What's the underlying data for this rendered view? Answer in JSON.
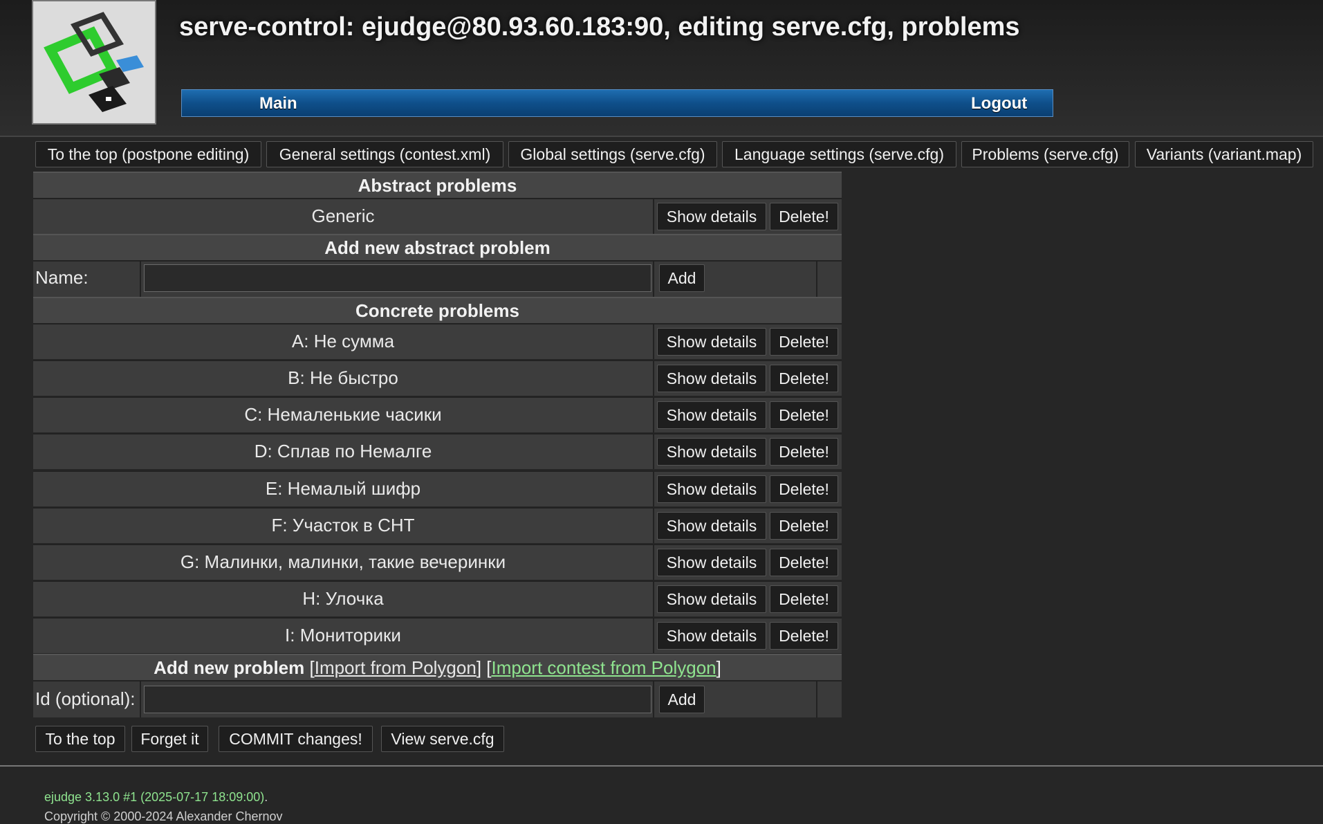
{
  "header": {
    "title": "serve-control: ejudge@80.93.60.183:90, editing serve.cfg, problems",
    "menu": {
      "main": "Main",
      "logout": "Logout"
    }
  },
  "nav": [
    "To the top (postpone editing)",
    "General settings (contest.xml)",
    "Global settings (serve.cfg)",
    "Language settings (serve.cfg)",
    "Problems (serve.cfg)",
    "Variants (variant.map)"
  ],
  "abstract": {
    "heading": "Abstract problems",
    "items": [
      "Generic"
    ],
    "add_heading": "Add new abstract problem",
    "name_label": "Name:",
    "name_value": "",
    "add_label": "Add"
  },
  "concrete": {
    "heading": "Concrete problems",
    "items": [
      "A: Не сумма",
      "B: Не быстро",
      "C: Немаленькие часики",
      "D: Сплав по Немалге",
      "E: Немалый шифр",
      "F: Участок в СНТ",
      "G: Малинки, малинки, такие вечеринки",
      "H: Улочка",
      "I: Мониторики"
    ],
    "show_details": "Show details",
    "delete": "Delete!"
  },
  "add_problem": {
    "heading": "Add new problem",
    "import_polygon": "Import from Polygon",
    "import_contest": "Import contest from Polygon",
    "id_label": "Id (optional):",
    "id_value": "",
    "add_label": "Add"
  },
  "bottom_buttons": [
    "To the top",
    "Forget it",
    "COMMIT changes!",
    "View serve.cfg"
  ],
  "footer": {
    "version_link": "ejudge 3.13.0 #1 (2025-07-17 18:09:00)",
    "copyright": "Copyright © 2000-2024 Alexander Chernov"
  }
}
